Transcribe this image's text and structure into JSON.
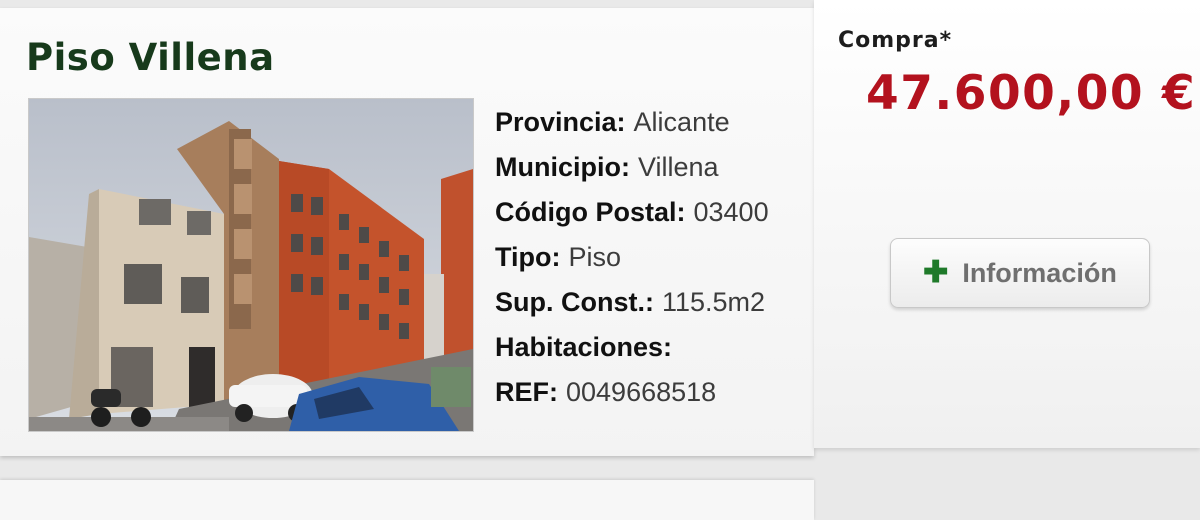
{
  "listing": {
    "title": "Piso Villena",
    "details": [
      {
        "label": "Provincia:",
        "value": "Alicante"
      },
      {
        "label": "Municipio:",
        "value": "Villena"
      },
      {
        "label": "Código Postal:",
        "value": "03400"
      },
      {
        "label": "Tipo:",
        "value": "Piso"
      },
      {
        "label": "Sup. Const.:",
        "value": "115.5m2"
      },
      {
        "label": "Habitaciones:",
        "value": ""
      },
      {
        "label": "REF:",
        "value": "0049668518"
      }
    ]
  },
  "side": {
    "buy_label": "Compra*",
    "price": "47.600,00 €",
    "info_button": {
      "icon": "plus-icon",
      "label": "Información"
    }
  },
  "colors": {
    "title": "#173a1b",
    "price": "#b3121e",
    "plus": "#1f7a2a"
  }
}
